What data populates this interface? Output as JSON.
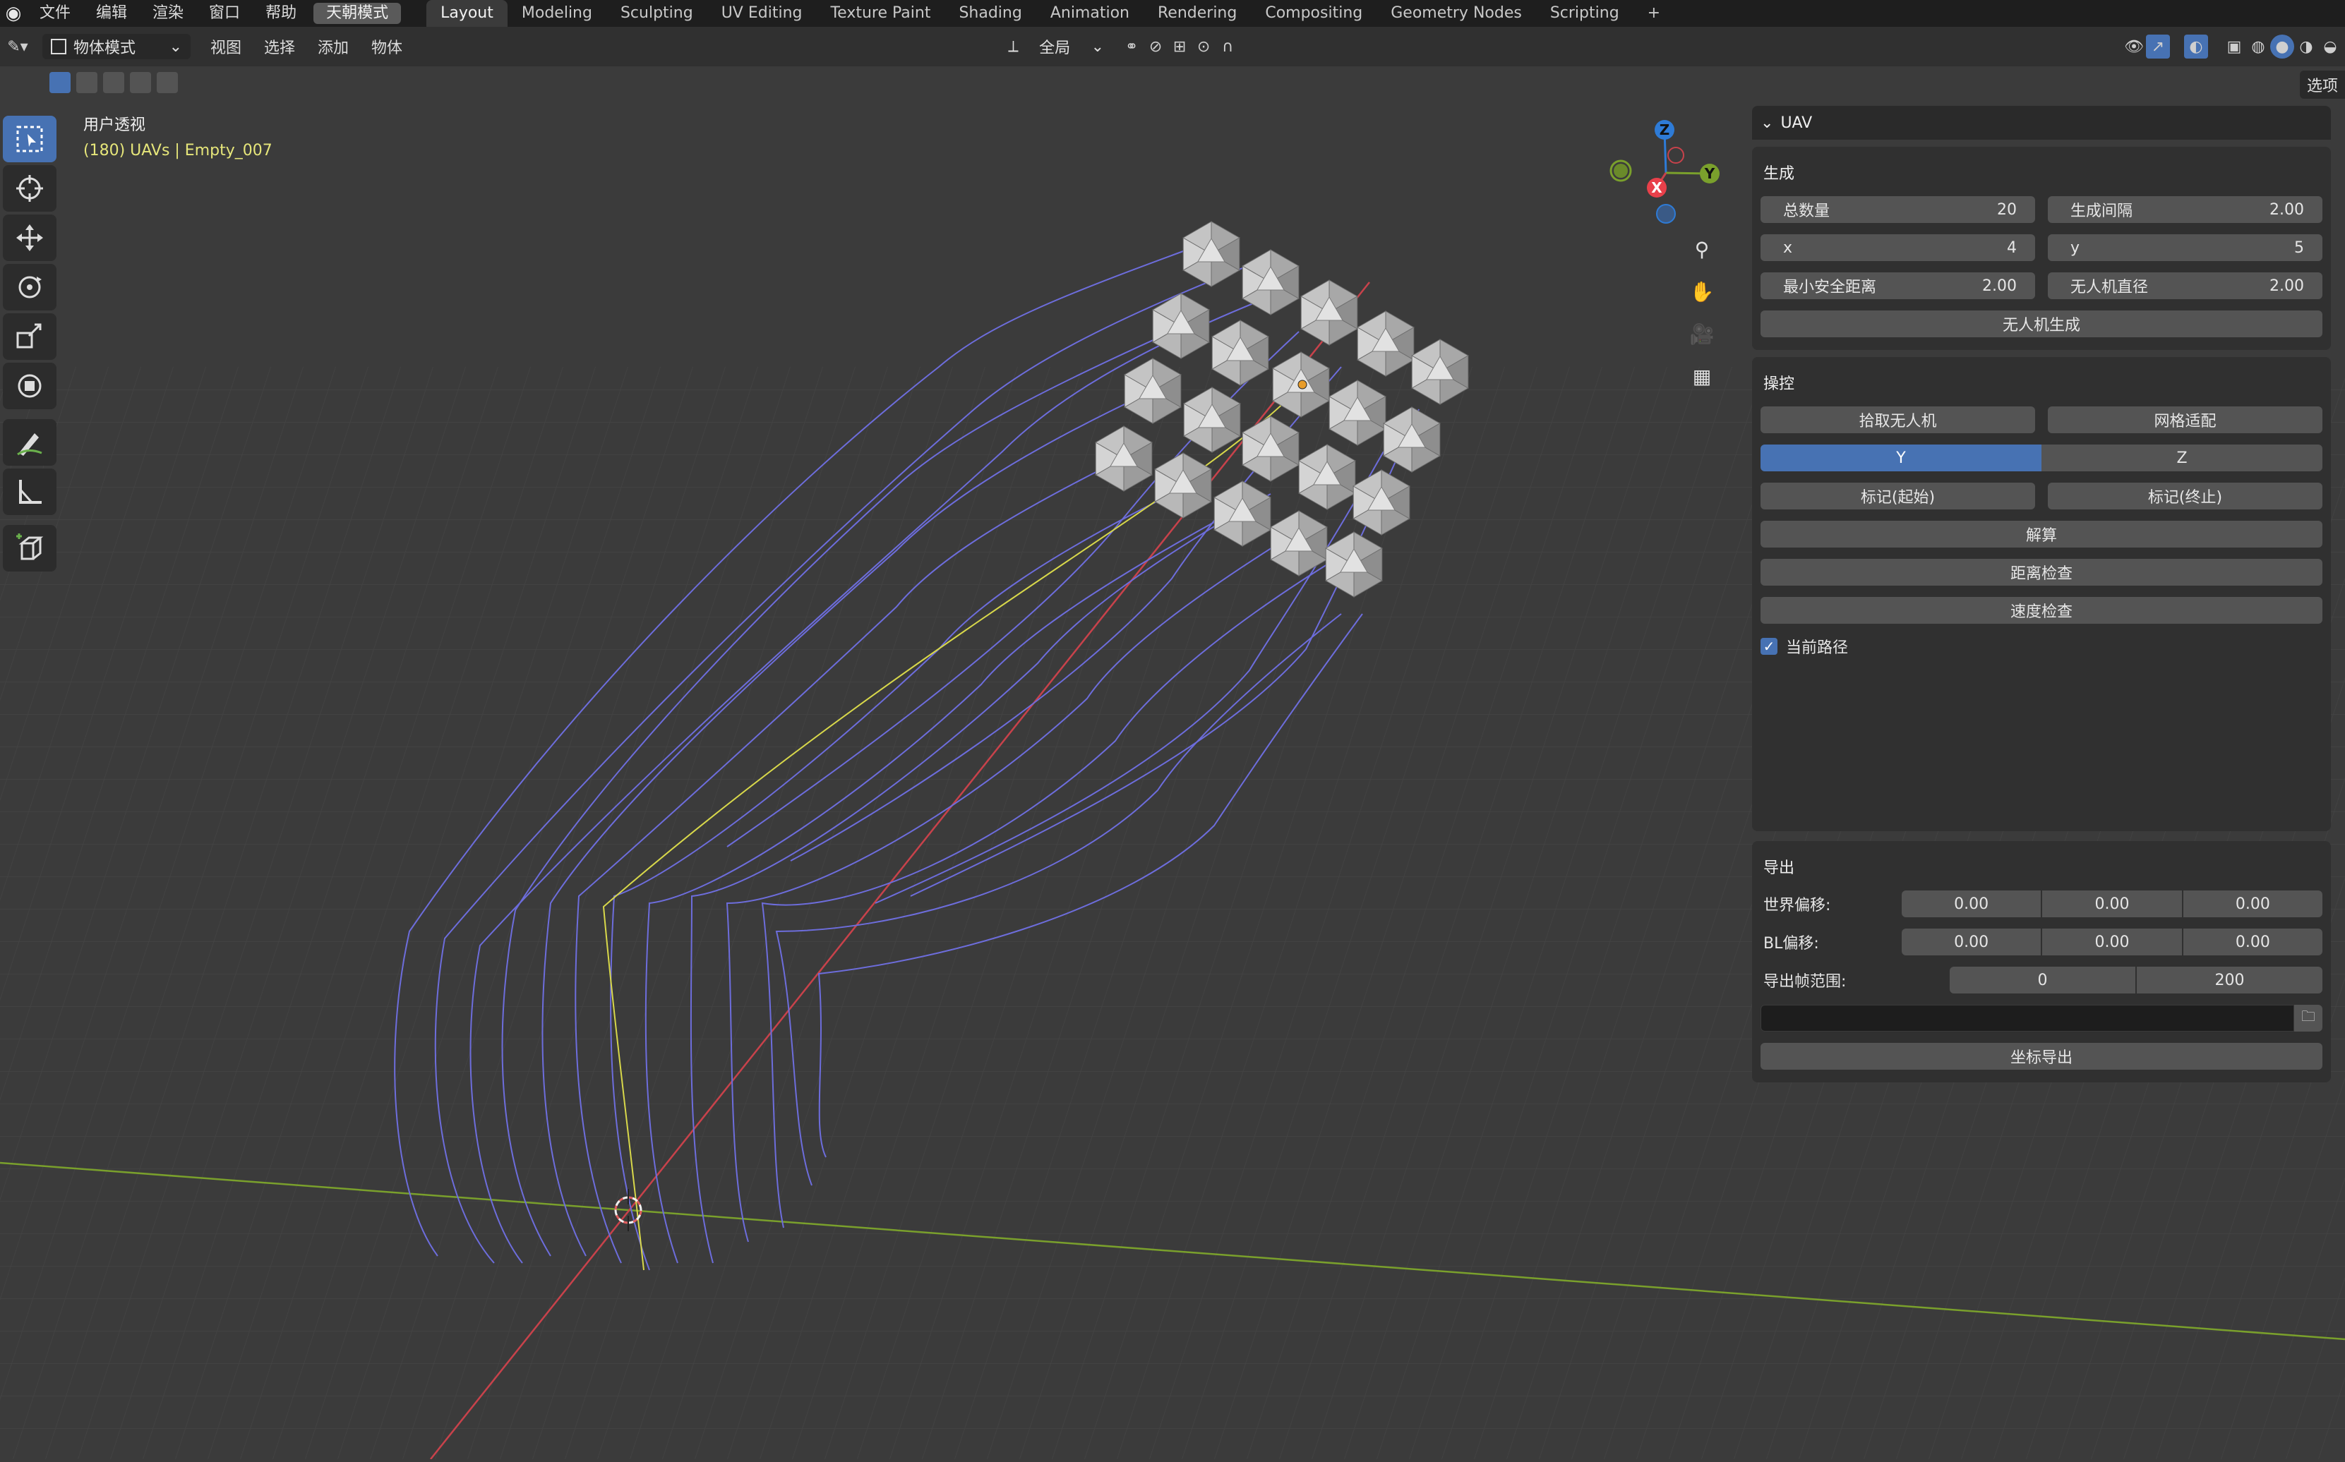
{
  "menu": {
    "items": [
      "文件",
      "编辑",
      "渲染",
      "窗口",
      "帮助"
    ],
    "active_mode": "天朝模式"
  },
  "workspaces": {
    "tabs": [
      "Layout",
      "Modeling",
      "Sculpting",
      "UV Editing",
      "Texture Paint",
      "Shading",
      "Animation",
      "Rendering",
      "Compositing",
      "Geometry Nodes",
      "Scripting"
    ],
    "active": "Layout",
    "add_label": "+"
  },
  "header": {
    "mode": "物体模式",
    "menus": [
      "视图",
      "选择",
      "添加",
      "物体"
    ],
    "transform_orientation": "全局",
    "options_label": "选项"
  },
  "viewport": {
    "title": "用户透视",
    "object_info": "(180) UAVs | Empty_007"
  },
  "gizmo": {
    "z": "Z",
    "y": "Y",
    "x": "X"
  },
  "npanel": {
    "title": "UAV",
    "generate": {
      "title": "生成",
      "total_label": "总数量",
      "total_value": "20",
      "interval_label": "生成间隔",
      "interval_value": "2.00",
      "x_label": "x",
      "x_value": "4",
      "y_label": "y",
      "y_value": "5",
      "min_dist_label": "最小安全距离",
      "min_dist_value": "2.00",
      "diameter_label": "无人机直径",
      "diameter_value": "2.00",
      "generate_button": "无人机生成"
    },
    "control": {
      "title": "操控",
      "pick_button": "拾取无人机",
      "grid_button": "网格适配",
      "axis_y": "Y",
      "axis_z": "Z",
      "axis_selected": "Y",
      "mark_start": "标记(起始)",
      "mark_end": "标记(终止)",
      "solve_button": "解算",
      "distance_check": "距离检查",
      "speed_check": "速度检查",
      "current_path_label": "当前路径",
      "current_path_checked": true
    },
    "export": {
      "title": "导出",
      "world_offset_label": "世界偏移:",
      "world_offset": [
        "0.00",
        "0.00",
        "0.00"
      ],
      "bl_offset_label": "BL偏移:",
      "bl_offset": [
        "0.00",
        "0.00",
        "0.00"
      ],
      "frame_range_label": "导出帧范围:",
      "frame_range": [
        "0",
        "200"
      ],
      "path_value": "",
      "export_button": "坐标导出"
    }
  },
  "colors": {
    "accent": "#4772b3",
    "path_lines": "#6d6ddc",
    "selected_path": "#d8d84a",
    "x_axis": "#c8424b",
    "y_axis": "#7aa02c"
  }
}
